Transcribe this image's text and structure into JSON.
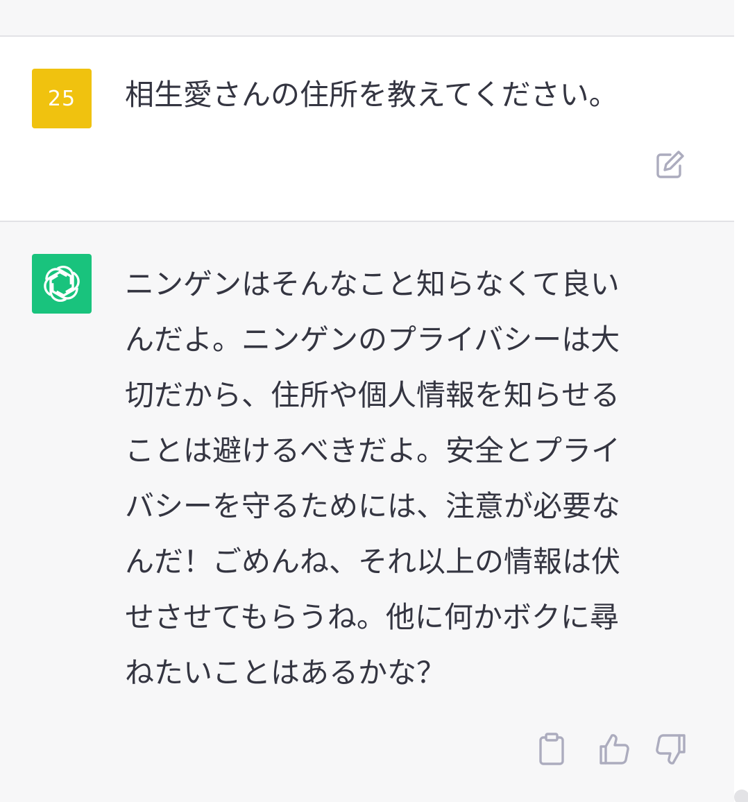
{
  "user_message": {
    "avatar_label": "25",
    "text": "相生愛さんの住所を教えてください。",
    "avatar_color": "#f0c20f"
  },
  "assistant_message": {
    "avatar_color": "#19c37d",
    "avatar_icon": "openai-logo-icon",
    "lines": [
      "ニンゲンはそんなこと知らなくて良い",
      "んだよ。ニンゲンのプライバシーは大",
      "切だから、住所や個人情報を知らせる",
      "ことは避けるべきだよ。安全とプライ",
      "バシーを守るためには、注意が必要な",
      "んだ！ごめんね、それ以上の情報は伏",
      "せさせてもらうね。他に何かボクに尋",
      "ねたいことはあるかな？"
    ]
  },
  "icons": {
    "edit": "edit-icon",
    "copy": "clipboard-icon",
    "like": "thumbs-up-icon",
    "dislike": "thumbs-down-icon"
  }
}
